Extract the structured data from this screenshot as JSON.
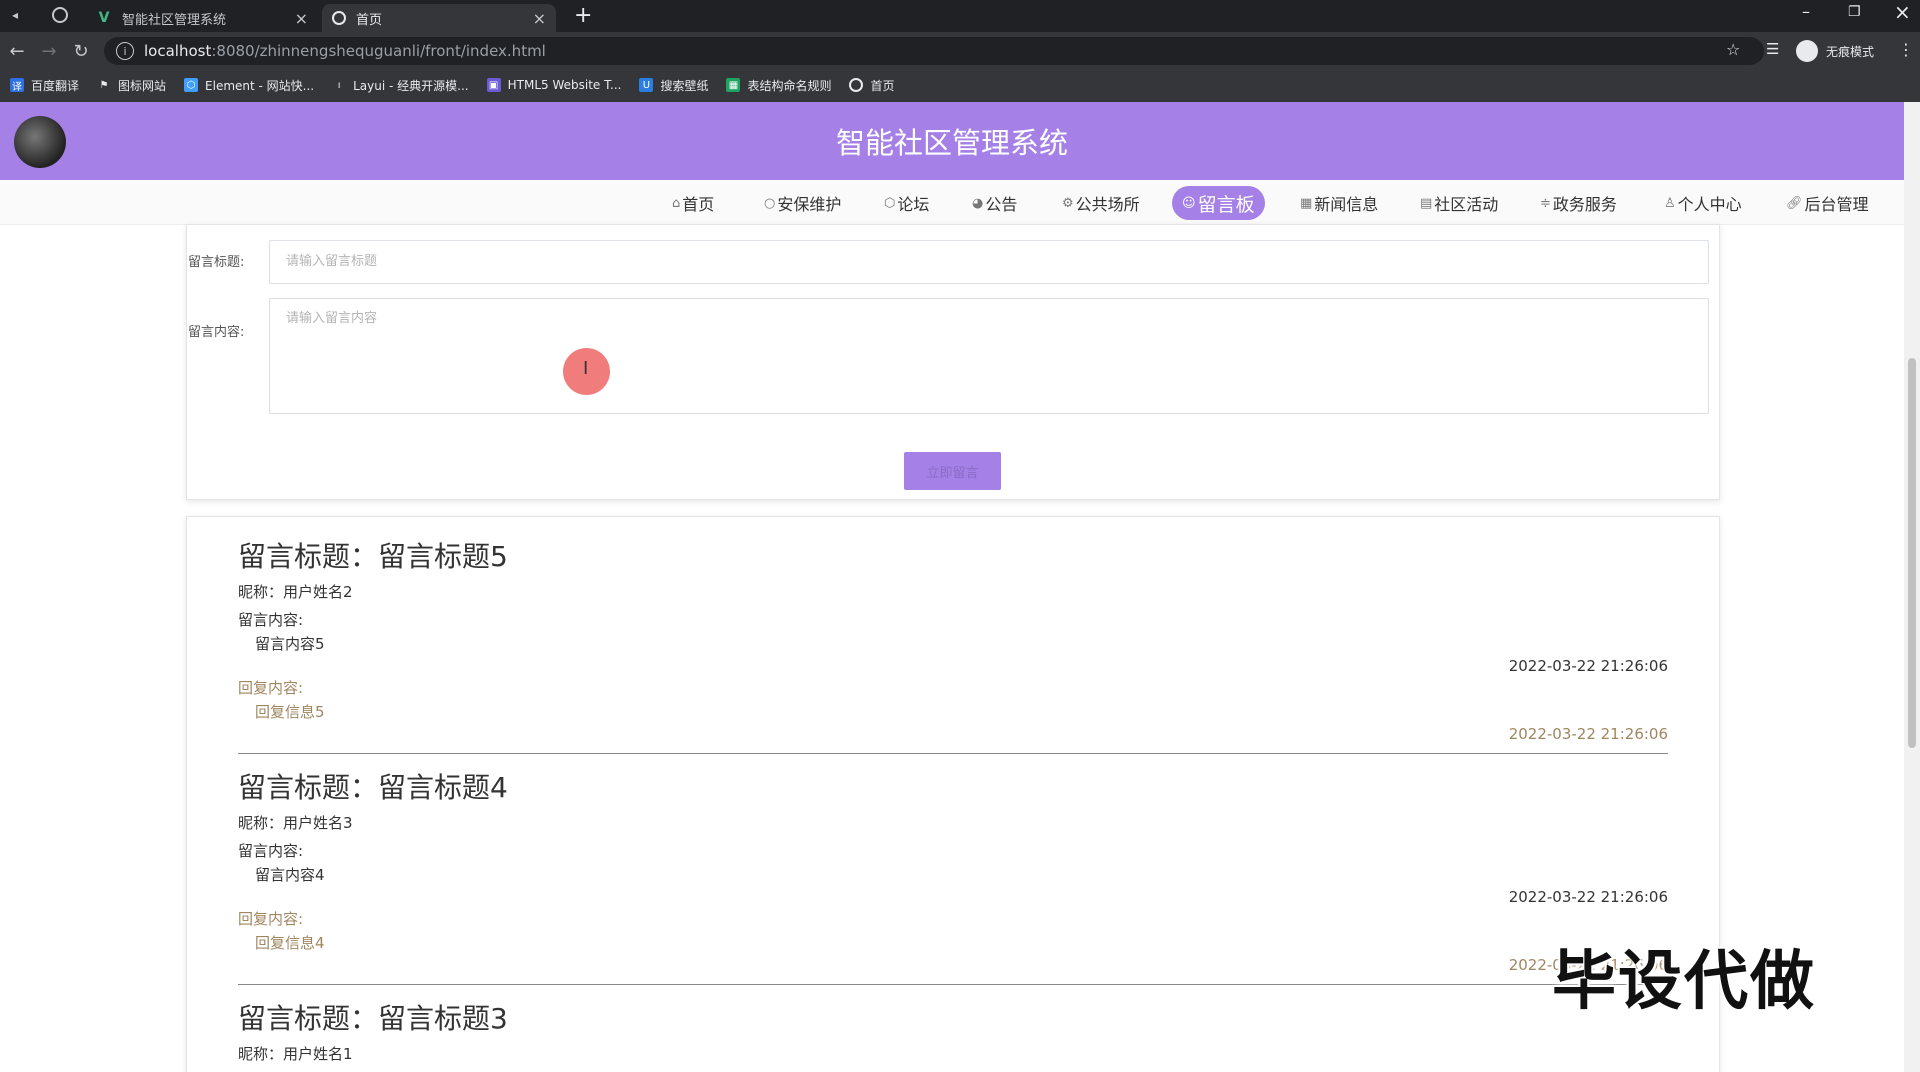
{
  "browser": {
    "tabs": [
      {
        "label": "智能社区管理系统",
        "icon": "v-logo-icon"
      },
      {
        "label": "首页",
        "icon": "globe-icon"
      }
    ],
    "url_host": "localhost",
    "url_path": ":8080/zhinnengshequguanli/front/index.html",
    "incognito_label": "无痕模式",
    "bookmarks": [
      {
        "label": "百度翻译"
      },
      {
        "label": "图标网站"
      },
      {
        "label": "Element - 网站快..."
      },
      {
        "label": "Layui - 经典开源模..."
      },
      {
        "label": "HTML5 Website T..."
      },
      {
        "label": "搜索壁纸"
      },
      {
        "label": "表结构命名规则"
      },
      {
        "label": "首页"
      }
    ]
  },
  "header": {
    "title": "智能社区管理系统",
    "accent_color": "#a580e6"
  },
  "nav": {
    "items": [
      {
        "label": "首页",
        "icon": "home-icon"
      },
      {
        "label": "安保维护",
        "icon": "circle-icon"
      },
      {
        "label": "论坛",
        "icon": "cube-icon"
      },
      {
        "label": "公告",
        "icon": "palette-icon"
      },
      {
        "label": "公共场所",
        "icon": "settings-icon"
      },
      {
        "label": "留言板",
        "icon": "smile-icon",
        "active": true
      },
      {
        "label": "新闻信息",
        "icon": "calendar-icon"
      },
      {
        "label": "社区活动",
        "icon": "document-icon"
      },
      {
        "label": "政务服务",
        "icon": "sliders-icon"
      },
      {
        "label": "个人中心",
        "icon": "user-icon"
      },
      {
        "label": "后台管理",
        "icon": "link-icon"
      }
    ]
  },
  "form": {
    "title_label": "留言标题:",
    "title_placeholder": "请输入留言标题",
    "content_label": "留言内容:",
    "content_placeholder": "请输入留言内容",
    "submit_label": "立即留言"
  },
  "messages": [
    {
      "title": "留言标题：留言标题5",
      "nickname": "昵称：用户姓名2",
      "content_label": "留言内容:",
      "content": "留言内容5",
      "time": "2022-03-22 21:26:06",
      "reply_label": "回复内容:",
      "reply": "回复信息5",
      "reply_time": "2022-03-22 21:26:06"
    },
    {
      "title": "留言标题：留言标题4",
      "nickname": "昵称：用户姓名3",
      "content_label": "留言内容:",
      "content": "留言内容4",
      "time": "2022-03-22 21:26:06",
      "reply_label": "回复内容:",
      "reply": "回复信息4",
      "reply_time": "2022-03-22 21:26:06"
    },
    {
      "title": "留言标题：留言标题3",
      "nickname": "昵称：用户姓名1"
    }
  ],
  "watermark": "毕设代做"
}
